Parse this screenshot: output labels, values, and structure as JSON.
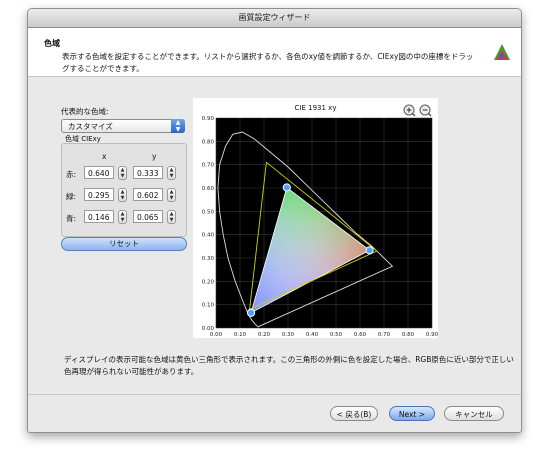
{
  "window": {
    "title": "画質設定ウィザード"
  },
  "header": {
    "title": "色域",
    "description": "表示する色域を設定することができます。リストから選択するか、各色のxy値を調節するか、CIExy図の中の座標をドラッグすることができます。"
  },
  "left": {
    "representative_label": "代表的な色域:",
    "popup_value": "カスタマイズ",
    "group_label": "色域 CIExy",
    "col_x": "x",
    "col_y": "y",
    "rows": [
      {
        "label": "赤:",
        "x": "0.640",
        "y": "0.333"
      },
      {
        "label": "緑:",
        "x": "0.295",
        "y": "0.602"
      },
      {
        "label": "青:",
        "x": "0.146",
        "y": "0.065"
      }
    ],
    "reset_label": "リセット"
  },
  "chart_data": {
    "type": "scatter",
    "title": "CIE 1931 xy",
    "xlim": [
      0,
      0.9
    ],
    "ylim": [
      0,
      0.9
    ],
    "x_ticks": [
      "0.00",
      "0.10",
      "0.20",
      "0.30",
      "0.40",
      "0.50",
      "0.60",
      "0.70",
      "0.80",
      "0.90"
    ],
    "y_ticks": [
      "0.00",
      "0.10",
      "0.20",
      "0.30",
      "0.40",
      "0.50",
      "0.60",
      "0.70",
      "0.80",
      "0.90"
    ],
    "grid": true,
    "triangle_points": [
      {
        "name": "赤",
        "x": 0.64,
        "y": 0.333
      },
      {
        "name": "緑",
        "x": 0.295,
        "y": 0.602
      },
      {
        "name": "青",
        "x": 0.146,
        "y": 0.065
      }
    ],
    "display_gamut_points": [
      {
        "x": 0.67,
        "y": 0.33
      },
      {
        "x": 0.21,
        "y": 0.71
      },
      {
        "x": 0.14,
        "y": 0.08
      }
    ],
    "spectral_locus": [
      [
        0.175,
        0.005
      ],
      [
        0.17,
        0.01
      ],
      [
        0.16,
        0.02
      ],
      [
        0.145,
        0.04
      ],
      [
        0.13,
        0.07
      ],
      [
        0.11,
        0.12
      ],
      [
        0.08,
        0.2
      ],
      [
        0.05,
        0.3
      ],
      [
        0.03,
        0.4
      ],
      [
        0.015,
        0.5
      ],
      [
        0.008,
        0.6
      ],
      [
        0.015,
        0.7
      ],
      [
        0.04,
        0.78
      ],
      [
        0.07,
        0.83
      ],
      [
        0.11,
        0.84
      ],
      [
        0.16,
        0.81
      ],
      [
        0.23,
        0.75
      ],
      [
        0.3,
        0.69
      ],
      [
        0.37,
        0.62
      ],
      [
        0.44,
        0.55
      ],
      [
        0.51,
        0.48
      ],
      [
        0.58,
        0.41
      ],
      [
        0.65,
        0.35
      ],
      [
        0.72,
        0.28
      ],
      [
        0.735,
        0.265
      ]
    ]
  },
  "note": "ディスプレイの表示可能な色域は黄色い三角形で表示されます。この三角形の外側に色を設定した場合、RGB原色に近い部分で正しい色再現が得られない可能性があります。",
  "buttons": {
    "back": "< 戻る(B)",
    "next": "Next >",
    "cancel": "キャンセル"
  },
  "colors": {
    "window_bg": "#e9e9e9",
    "accent": "#2a64c9",
    "gamut_yellow": "#d4d400"
  },
  "icons": {
    "zoom_in": "zoom-in-icon",
    "zoom_out": "zoom-out-icon",
    "logo": "color-gamut-icon"
  }
}
